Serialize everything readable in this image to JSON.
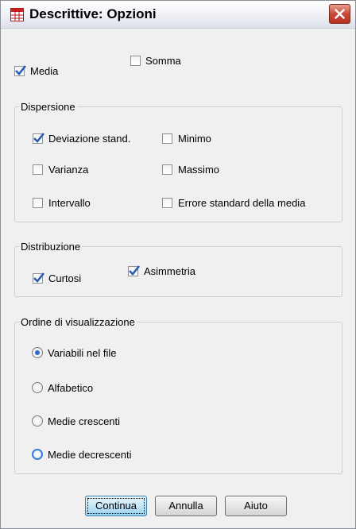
{
  "window": {
    "title": "Descrittive: Opzioni"
  },
  "top_options": [
    {
      "label": "Media",
      "checked": true
    },
    {
      "label": "Somma",
      "checked": false
    }
  ],
  "dispersion": {
    "title": "Dispersione",
    "items": [
      {
        "label": "Deviazione stand.",
        "checked": true
      },
      {
        "label": "Minimo",
        "checked": false
      },
      {
        "label": "Varianza",
        "checked": false
      },
      {
        "label": "Massimo",
        "checked": false
      },
      {
        "label": "Intervallo",
        "checked": false
      },
      {
        "label": "Errore standard della media",
        "checked": false
      }
    ]
  },
  "distribution": {
    "title": "Distribuzione",
    "items": [
      {
        "label": "Curtosi",
        "checked": true
      },
      {
        "label": "Asimmetria",
        "checked": true
      }
    ]
  },
  "display_order": {
    "title": "Ordine di visualizzazione",
    "options": [
      {
        "label": "Variabili nel file",
        "selected": true
      },
      {
        "label": "Alfabetico",
        "selected": false
      },
      {
        "label": "Medie crescenti",
        "selected": false
      },
      {
        "label": "Medie decrescenti",
        "selected": false
      }
    ]
  },
  "buttons": {
    "continue": "Continua",
    "cancel": "Annulla",
    "help": "Aiuto"
  },
  "colors": {
    "check": "#2b5eb5",
    "radio_dot": "#2a69c9",
    "close_button": "#c8493a"
  }
}
